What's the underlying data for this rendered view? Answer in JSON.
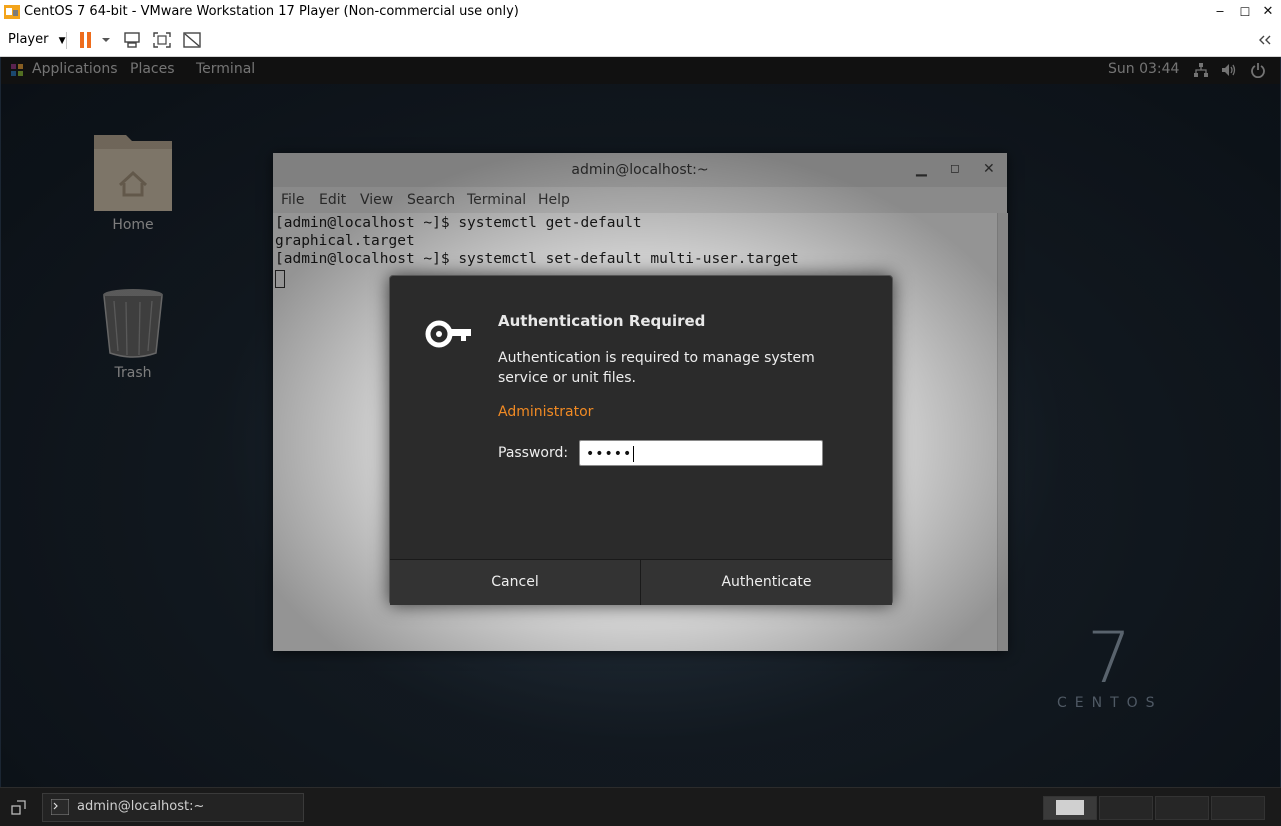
{
  "window": {
    "title": "CentOS 7 64-bit - VMware Workstation 17 Player (Non-commercial use only)",
    "controls": {
      "minimize": "‒",
      "maximize": "☐",
      "close": "✕"
    }
  },
  "toolbar": {
    "player_label": "Player",
    "icons": [
      "pause-icon",
      "dropdown-icon",
      "send-ctrl-alt-del-icon",
      "fullscreen-icon",
      "unity-icon",
      "collapse-toolbar-icon"
    ]
  },
  "gnome_panel": {
    "menus": [
      "Applications",
      "Places",
      "Terminal"
    ],
    "clock": "Sun 03:44",
    "tray_icons": [
      "network-icon",
      "volume-icon",
      "power-icon"
    ]
  },
  "desktop": {
    "icons": [
      {
        "label": "Home"
      },
      {
        "label": "Trash"
      }
    ],
    "branding": {
      "number": "7",
      "word": "CENTOS"
    }
  },
  "terminal": {
    "title": "admin@localhost:~",
    "menu": [
      "File",
      "Edit",
      "View",
      "Search",
      "Terminal",
      "Help"
    ],
    "lines": [
      "[admin@localhost ~]$ systemctl get-default",
      "graphical.target",
      "[admin@localhost ~]$ systemctl set-default multi-user.target"
    ]
  },
  "auth_dialog": {
    "heading": "Authentication Required",
    "message": "Authentication is required to manage system service or unit files.",
    "user": "Administrator",
    "password_label": "Password:",
    "password_value": "•••••",
    "cancel_label": "Cancel",
    "authenticate_label": "Authenticate"
  },
  "taskbar": {
    "task_label": "admin@localhost:~",
    "workspaces": 4,
    "active_workspace": 1
  }
}
